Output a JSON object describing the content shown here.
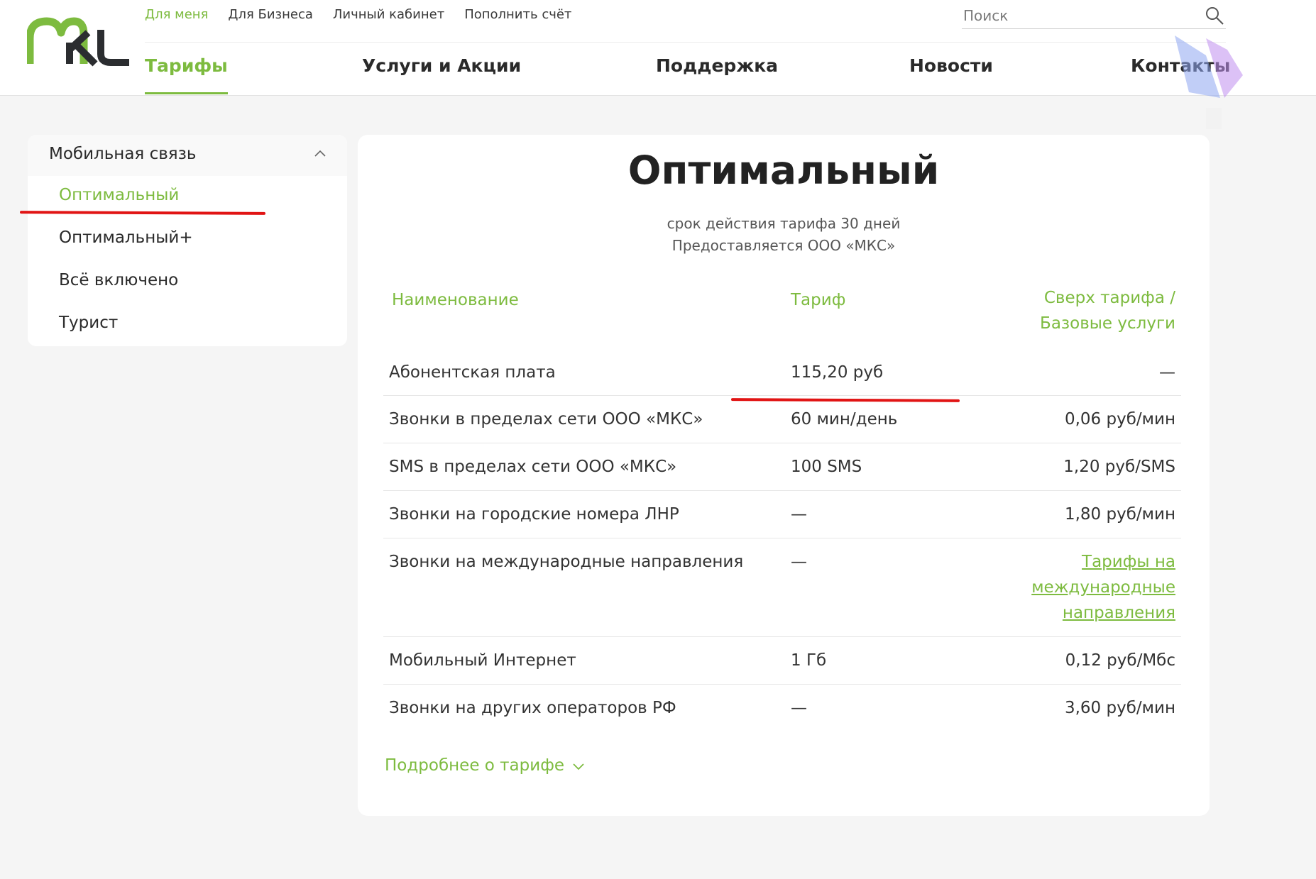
{
  "header": {
    "logo_text": "МКС",
    "top_nav": [
      {
        "label": "Для меня",
        "active": true
      },
      {
        "label": "Для Бизнеса",
        "active": false
      },
      {
        "label": "Личный кабинет",
        "active": false
      },
      {
        "label": "Пополнить счёт",
        "active": false
      }
    ],
    "search": {
      "placeholder": "Поиск"
    },
    "main_nav": [
      {
        "label": "Тарифы",
        "active": true
      },
      {
        "label": "Услуги и Акции",
        "active": false
      },
      {
        "label": "Поддержка",
        "active": false
      },
      {
        "label": "Новости",
        "active": false
      },
      {
        "label": "Контакты",
        "active": false
      }
    ]
  },
  "sidebar": {
    "section_title": "Мобильная связь",
    "items": [
      {
        "label": "Оптимальный",
        "active": true
      },
      {
        "label": "Оптимальный+",
        "active": false
      },
      {
        "label": "Всё включено",
        "active": false
      },
      {
        "label": "Турист",
        "active": false
      }
    ]
  },
  "tariff": {
    "title": "Оптимальный",
    "subtitle_line1": "срок действия тарифа 30 дней",
    "subtitle_line2": "Предоставляется ООО «МКС»",
    "columns": {
      "name": "Наименование",
      "tariff": "Тариф",
      "extra_line1": "Сверх тарифа /",
      "extra_line2": "Базовые услуги"
    },
    "rows": [
      {
        "name": "Абонентская плата",
        "tariff": "115,20 руб",
        "extra": "—"
      },
      {
        "name": "Звонки в пределах сети ООО «МКС»",
        "tariff": "60 мин/день",
        "extra": "0,06 руб/мин"
      },
      {
        "name": "SMS в пределах сети ООО «МКС»",
        "tariff": "100 SMS",
        "extra": "1,20 руб/SMS"
      },
      {
        "name": "Звонки на городские номера ЛНР",
        "tariff": "—",
        "extra": "1,80 руб/мин"
      },
      {
        "name": "Звонки на международные направления",
        "tariff": "—",
        "extra_link_line1": "Тарифы на",
        "extra_link_line2": "международные",
        "extra_link_line3": "направления"
      },
      {
        "name": "Мобильный Интернет",
        "tariff": "1 Гб",
        "extra": "0,12 руб/Мбс"
      },
      {
        "name": "Звонки на других операторов РФ",
        "tariff": "—",
        "extra": "3,60 руб/мин"
      }
    ],
    "more_label": "Подробнее о тарифе"
  },
  "colors": {
    "accent": "#7dbb3f",
    "logo_dark": "#2b2d30",
    "annotation": "#e11414"
  }
}
